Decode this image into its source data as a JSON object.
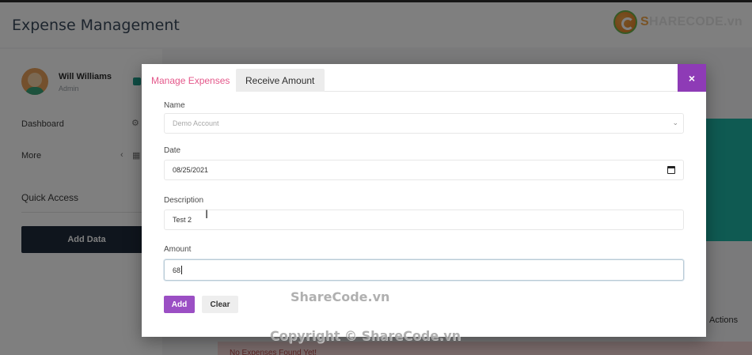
{
  "app": {
    "title": "Expense Management",
    "brand": {
      "prefix": "S",
      "main": "HARECODE",
      "suffix": ".vn"
    }
  },
  "sidebar": {
    "user": {
      "name": "Will Williams",
      "role": "Admin"
    },
    "items": [
      {
        "label": "Dashboard",
        "icon": "gear-icon"
      },
      {
        "label": "More",
        "icon": "grid-icon"
      }
    ],
    "quick_access_title": "Quick Access",
    "add_data_label": "Add Data"
  },
  "background": {
    "table_actions_header": "Actions",
    "empty_message": "No Expenses Found Yet!"
  },
  "modal": {
    "tabs": [
      {
        "label": "Manage Expenses",
        "active": true
      },
      {
        "label": "Receive Amount",
        "active": false
      }
    ],
    "close_label": "×",
    "fields": {
      "name": {
        "label": "Name",
        "value": "Demo Account"
      },
      "date": {
        "label": "Date",
        "value": "08/25/2021"
      },
      "description": {
        "label": "Description",
        "value": "Test 2"
      },
      "amount": {
        "label": "Amount",
        "value": "68"
      }
    },
    "add_label": "Add",
    "clear_label": "Clear"
  },
  "watermarks": {
    "center": "ShareCode.vn",
    "bottom": "Copyright © ShareCode.vn"
  },
  "colors": {
    "accent_tab": "#e4578a",
    "primary_button": "#9b4fc4",
    "close_button": "#8e3bb6",
    "sidebar_button": "#1e2b3b",
    "teal": "#1fb5a5"
  }
}
